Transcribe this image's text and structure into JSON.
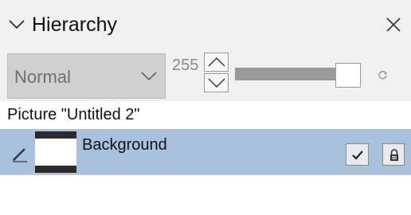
{
  "panel": {
    "title": "Hierarchy",
    "collapse_icon": "chevron-down-icon",
    "close_icon": "close-icon"
  },
  "controls": {
    "blend_mode": {
      "selected": "Normal",
      "icon": "chevron-down-icon"
    },
    "opacity": {
      "value": "255",
      "fraction": 1.0,
      "up_icon": "chevron-up-icon",
      "down_icon": "chevron-down-icon"
    },
    "reset_icon": "reset-icon"
  },
  "picture": {
    "label": "Picture \"Untitled 2\""
  },
  "layers": [
    {
      "name": "Background",
      "edit_icon": "pencil-icon",
      "visible": true,
      "visible_icon": "checkmark-icon",
      "lock_icon": "lock-icon",
      "selected": true
    }
  ],
  "colors": {
    "header_bg": "#f0f0f0",
    "selected_row": "#a8c2de",
    "select_bg": "#d0d0d0",
    "slider": "#9a9a9a"
  }
}
